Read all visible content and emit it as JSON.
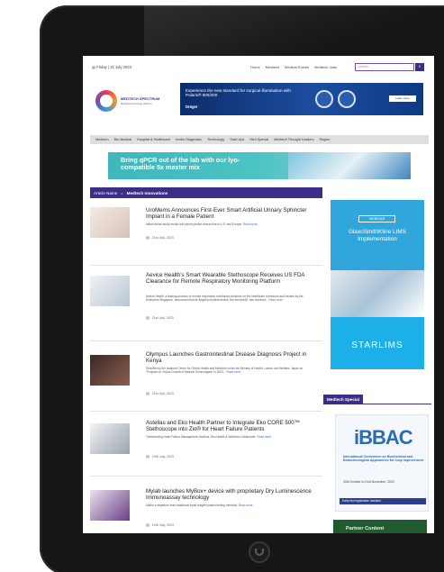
{
  "site": {
    "date": "Friday | 21 July 2023",
    "top_links": [
      "Home",
      "Medtech",
      "Medical Events",
      "Medtech Jobs"
    ],
    "search_placeholder": "search",
    "logo_name": "MEDTECH SPECTRUM",
    "logo_tagline": "Medical technology platform"
  },
  "ads": {
    "top_banner": {
      "headline": "Experience the new standard for surgical illumination with Polaris® 600/200",
      "brand": "Dräger",
      "cta": "Learn more"
    },
    "mid_banner": {
      "headline": "Bring qPCR out of the lab with our lyo-compatible 5x master mix"
    }
  },
  "nav": {
    "items": [
      "Medtech",
      "Bio Medical",
      "Hospital & Healthcare",
      "Invitro Diagnostic",
      "Technology",
      "Start-Ups",
      "Med Special",
      "Medtech Thought Leaders",
      "Region"
    ]
  },
  "breadcrumb": {
    "root": "Article Name",
    "separator": ">",
    "current": "Medtech Innovations"
  },
  "articles": [
    {
      "title": "UroMems Announces First-Ever Smart Artificial Urinary Sphincter Implant in a Female Patient",
      "excerpt": "Initial clinical study results will inform pivotal clinical trial in U.S. and Europe.",
      "more": "Read more",
      "date": "21st July, 2023"
    },
    {
      "title": "Aevice Health’s Smart Wearable Stethoscope Receives US FDA Clearance for Remote Respiratory Monitoring Platform",
      "excerpt": "Aevice Health, a leading provider of remote respiratory monitoring solutions for the healthcare continuum and backed by the Enterprise Singapore, announced that its flagship medical device, the AeviceMD, has received...",
      "more": "Read more",
      "date": "21st July, 2023"
    },
    {
      "title": "Olympus Launches Gastrointestinal Disease Diagnosis Project in Kenya",
      "excerpt": "Selected by the National Center for Global Health and Medicine under the Ministry of Health, Labour and Welfare, Japan as \"Projects for Global Growth of Medical Technologies\" in 2023...",
      "more": "Read more",
      "date": "21st July, 2023"
    },
    {
      "title": "Astellas and Eko Health Partner to Integrate Eko CORE 500™ Stethoscope into Zio® for Heart Failure Patients",
      "excerpt": "Transforming Heart Failure Management: Astellas, Eko Health & Wellness Collaborate.",
      "more": "Read more",
      "date": "19th July, 2023"
    },
    {
      "title": "Mylab launches MyBox+ device with proprietary Dry Luminescence Immunoassay technology",
      "excerpt": "Marks a departure from traditional liquid reagent-based testing methods.",
      "more": "Read more",
      "date": "19th July, 2023"
    }
  ],
  "sidebar": {
    "webinar_tag": "WEBINAR",
    "webinar_heading": "GlaxoSmithKline LIMS Implementation",
    "webinar_brand": "STARLIMS",
    "section_title": "Medtech Special",
    "event_logo": "iBBAC",
    "event_title": "International Conference on Biochemical and Biotechnological Approaches for Crop Improvement",
    "event_dates": "30th October to 01st November, 2023",
    "event_bar": "Early bird registration deadline",
    "sponsored": "Partner Content"
  }
}
